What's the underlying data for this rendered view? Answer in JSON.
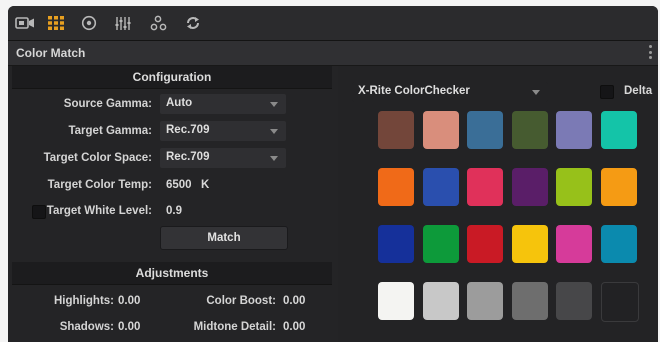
{
  "toolbar": {
    "icons": [
      "camera-icon",
      "color-grid-icon",
      "target-icon",
      "sliders-icon",
      "nodes-icon",
      "refresh-icon"
    ],
    "active_color": "#e8a020"
  },
  "panel": {
    "title": "Color Match"
  },
  "configuration": {
    "header": "Configuration",
    "source_gamma": {
      "label": "Source Gamma:",
      "value": "Auto"
    },
    "target_gamma": {
      "label": "Target Gamma:",
      "value": "Rec.709"
    },
    "target_color_space": {
      "label": "Target Color Space:",
      "value": "Rec.709"
    },
    "target_color_temp": {
      "label": "Target Color Temp:",
      "value": "6500",
      "unit": "K"
    },
    "target_white_level": {
      "label": "Target White Level:",
      "value": "0.9",
      "checked": false
    },
    "match_button": "Match"
  },
  "adjustments": {
    "header": "Adjustments",
    "highlights": {
      "label": "Highlights:",
      "value": "0.00"
    },
    "color_boost": {
      "label": "Color Boost:",
      "value": "0.00"
    },
    "shadows": {
      "label": "Shadows:",
      "value": "0.00"
    },
    "midtone_detail": {
      "label": "Midtone Detail:",
      "value": "0.00"
    }
  },
  "chart": {
    "selector": "X-Rite ColorChecker",
    "delta_label": "Delta",
    "delta_checked": false,
    "swatches": [
      [
        "#73463a",
        "#d98e7c",
        "#3a6e97",
        "#465b30",
        "#7b7ab5",
        "#14c4a8"
      ],
      [
        "#f06a18",
        "#2a4fae",
        "#e0315a",
        "#5a1e68",
        "#97c11a",
        "#f59b14"
      ],
      [
        "#15309a",
        "#0d9a3a",
        "#c91a25",
        "#f6c40c",
        "#d63b9a",
        "#0b8aae"
      ],
      [
        "#f4f4f2",
        "#c8c8c8",
        "#9c9c9c",
        "#6e6e6e",
        "#474749",
        "#222224"
      ]
    ]
  }
}
